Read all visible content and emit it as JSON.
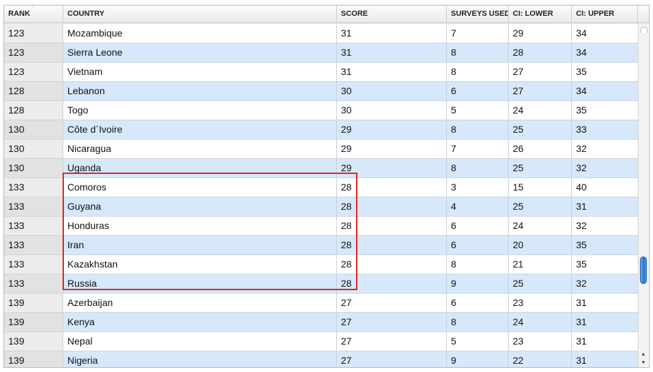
{
  "columns": {
    "rank": "RANK",
    "country": "COUNTRY",
    "score": "SCORE",
    "surveys": "SURVEYS USED",
    "lower": "CI: LOWER",
    "upper": "CI: UPPER"
  },
  "sort_indicator": "ˆ",
  "rows": [
    {
      "rank": "123",
      "country": "Mozambique",
      "score": "31",
      "surveys": "7",
      "lower": "29",
      "upper": "34"
    },
    {
      "rank": "123",
      "country": "Sierra Leone",
      "score": "31",
      "surveys": "8",
      "lower": "28",
      "upper": "34"
    },
    {
      "rank": "123",
      "country": "Vietnam",
      "score": "31",
      "surveys": "8",
      "lower": "27",
      "upper": "35"
    },
    {
      "rank": "128",
      "country": "Lebanon",
      "score": "30",
      "surveys": "6",
      "lower": "27",
      "upper": "34"
    },
    {
      "rank": "128",
      "country": "Togo",
      "score": "30",
      "surveys": "5",
      "lower": "24",
      "upper": "35"
    },
    {
      "rank": "130",
      "country": "Côte d´Ivoire",
      "score": "29",
      "surveys": "8",
      "lower": "25",
      "upper": "33"
    },
    {
      "rank": "130",
      "country": "Nicaragua",
      "score": "29",
      "surveys": "7",
      "lower": "26",
      "upper": "32"
    },
    {
      "rank": "130",
      "country": "Uganda",
      "score": "29",
      "surveys": "8",
      "lower": "25",
      "upper": "32"
    },
    {
      "rank": "133",
      "country": "Comoros",
      "score": "28",
      "surveys": "3",
      "lower": "15",
      "upper": "40"
    },
    {
      "rank": "133",
      "country": "Guyana",
      "score": "28",
      "surveys": "4",
      "lower": "25",
      "upper": "31"
    },
    {
      "rank": "133",
      "country": "Honduras",
      "score": "28",
      "surveys": "6",
      "lower": "24",
      "upper": "32"
    },
    {
      "rank": "133",
      "country": "Iran",
      "score": "28",
      "surveys": "6",
      "lower": "20",
      "upper": "35"
    },
    {
      "rank": "133",
      "country": "Kazakhstan",
      "score": "28",
      "surveys": "8",
      "lower": "21",
      "upper": "35"
    },
    {
      "rank": "133",
      "country": "Russia",
      "score": "28",
      "surveys": "9",
      "lower": "25",
      "upper": "32"
    },
    {
      "rank": "139",
      "country": "Azerbaijan",
      "score": "27",
      "surveys": "6",
      "lower": "23",
      "upper": "31"
    },
    {
      "rank": "139",
      "country": "Kenya",
      "score": "27",
      "surveys": "8",
      "lower": "24",
      "upper": "31"
    },
    {
      "rank": "139",
      "country": "Nepal",
      "score": "27",
      "surveys": "5",
      "lower": "23",
      "upper": "31"
    },
    {
      "rank": "139",
      "country": "Nigeria",
      "score": "27",
      "surveys": "9",
      "lower": "22",
      "upper": "31"
    }
  ],
  "scrollbar": {
    "up_arrow": "▲",
    "down_arrow": "▼"
  },
  "colors": {
    "row_alt": "#d6e8f9",
    "highlight": "#e0231b",
    "thumb": "#2a74d0"
  }
}
